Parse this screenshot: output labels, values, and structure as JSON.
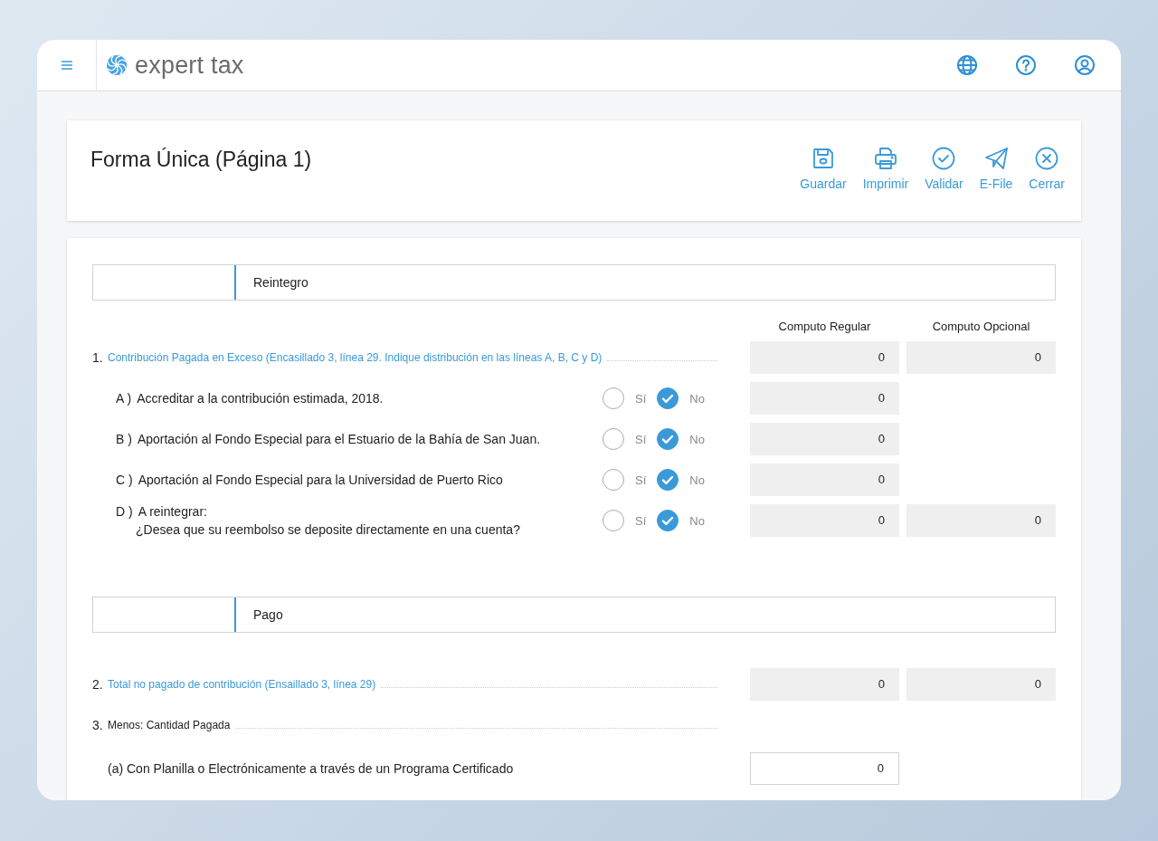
{
  "header": {
    "brand": "expert tax"
  },
  "page": {
    "title": "Forma Única (Página 1)",
    "actions": [
      {
        "kind": "save",
        "label": "Guardar"
      },
      {
        "kind": "print",
        "label": "Imprimir"
      },
      {
        "kind": "validate",
        "label": "Validar"
      },
      {
        "kind": "send",
        "label": "E-File"
      },
      {
        "kind": "close",
        "label": "Cerrar"
      }
    ]
  },
  "sections": [
    {
      "title": "Reintegro",
      "columns": [
        "Computo Regular",
        "Computo Opcional"
      ],
      "lines": [
        {
          "kind": "numbered",
          "number": "1.",
          "label": "Contribución Pagada en Exceso (Encasillado 3, línea 29. Indique distribución en las líneas A, B, C y D)",
          "link": true,
          "values": [
            {
              "text": "0",
              "editable": false
            },
            {
              "text": "0",
              "editable": false
            }
          ]
        },
        {
          "kind": "choice",
          "letter": "A )",
          "text": "Accreditar a la contribución estimada, 2018.",
          "options": [
            {
              "label": "Sí",
              "selected": false
            },
            {
              "label": "No",
              "selected": true
            }
          ],
          "values": [
            {
              "text": "0",
              "editable": false
            }
          ]
        },
        {
          "kind": "choice",
          "letter": "B )",
          "text": "Aportación al Fondo Especial para el Estuario de la Bahía de San Juan.",
          "options": [
            {
              "label": "Sí",
              "selected": false
            },
            {
              "label": "No",
              "selected": true
            }
          ],
          "values": [
            {
              "text": "0",
              "editable": false
            }
          ]
        },
        {
          "kind": "choice",
          "letter": "C )",
          "text": "Aportación al Fondo Especial para la Universidad de Puerto Rico",
          "options": [
            {
              "label": "Sí",
              "selected": false
            },
            {
              "label": "No",
              "selected": true
            }
          ],
          "values": [
            {
              "text": "0",
              "editable": false
            }
          ]
        },
        {
          "kind": "choice",
          "letter": "D )",
          "text": "A reintegrar:",
          "note": "¿Desea que su reembolso se deposite directamente en una cuenta?",
          "options": [
            {
              "label": "Sí",
              "selected": false
            },
            {
              "label": "No",
              "selected": true
            }
          ],
          "values": [
            {
              "text": "0",
              "editable": false
            },
            {
              "text": "0",
              "editable": false
            }
          ]
        }
      ]
    },
    {
      "title": "Pago",
      "lines": [
        {
          "kind": "numbered",
          "number": "2.",
          "label": "Total no pagado de contribución (Ensaillado 3, línea 29)",
          "link": true,
          "values": [
            {
              "text": "0",
              "editable": false
            },
            {
              "text": "0",
              "editable": false
            }
          ]
        },
        {
          "kind": "numbered",
          "number": "3.",
          "label": "Menos: Cantidad Pagada",
          "link": false
        },
        {
          "kind": "plain",
          "text": "(a) Con Planilla o Electrónicamente a través de un Programa Certificado",
          "values": [
            {
              "text": "0",
              "editable": true
            }
          ]
        }
      ]
    }
  ]
}
